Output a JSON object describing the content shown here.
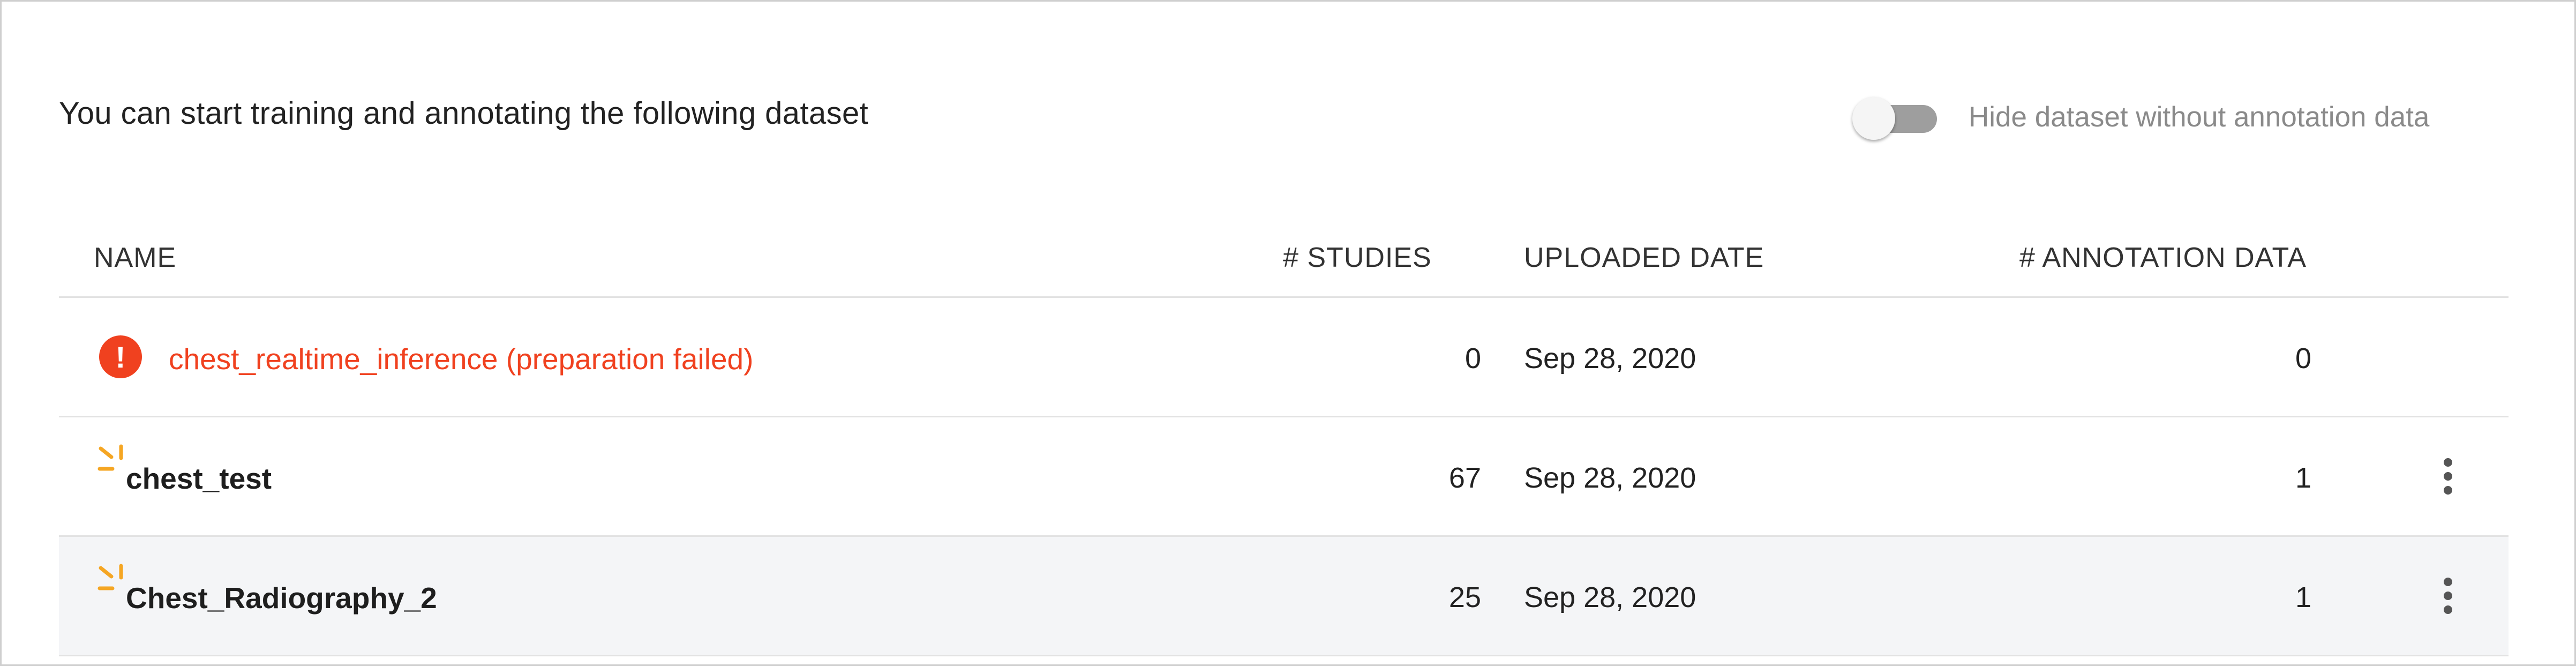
{
  "intro_text": "You can start training and annotating the following dataset",
  "toggle": {
    "label": "Hide dataset without annotation data",
    "checked": false
  },
  "table": {
    "columns": [
      "NAME",
      "# STUDIES",
      "UPLOADED DATE",
      "# ANNOTATION DATA"
    ],
    "rows": [
      {
        "name": "chest_realtime_inference (preparation failed)",
        "studies": "0",
        "uploaded": "Sep 28, 2020",
        "annotations": "0",
        "status": "error",
        "icon": "error-icon"
      },
      {
        "name": "chest_test",
        "studies": "67",
        "uploaded": "Sep 28, 2020",
        "annotations": "1",
        "status": "new",
        "icon": "sparkle-icon"
      },
      {
        "name": "Chest_Radiography_2",
        "studies": "25",
        "uploaded": "Sep 28, 2020",
        "annotations": "1",
        "status": "new",
        "icon": "sparkle-icon"
      }
    ]
  },
  "colors": {
    "error": "#f0411f",
    "sparkle": "#f5a623",
    "toggle_track": "#9e9e9e",
    "row_alt": "#f4f5f7"
  }
}
